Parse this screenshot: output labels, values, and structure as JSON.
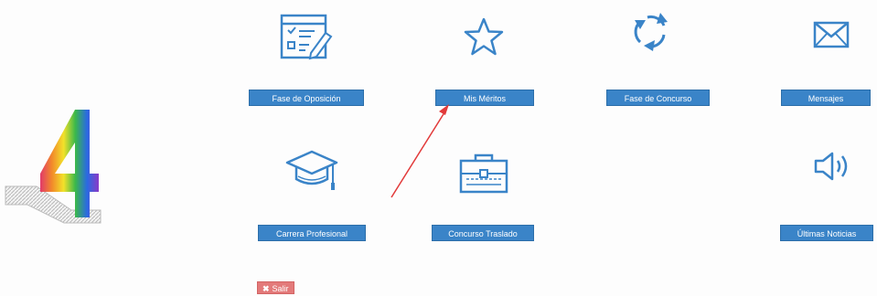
{
  "logo": {
    "glyph": "4"
  },
  "tiles": [
    {
      "label": "Fase de Oposición",
      "icon": "form-icon"
    },
    {
      "label": "Mis Méritos",
      "icon": "star-icon"
    },
    {
      "label": "Fase de Concurso",
      "icon": "refresh-icon"
    },
    {
      "label": "Mensajes",
      "icon": "envelope-icon"
    },
    {
      "label": "Carrera Profesional",
      "icon": "graduation-cap-icon"
    },
    {
      "label": "Concurso Traslado",
      "icon": "briefcase-icon"
    },
    {
      "label": "Últimas Noticias",
      "icon": "speaker-icon"
    }
  ],
  "exit": {
    "label": "Salir",
    "icon": "close-icon"
  },
  "colors": {
    "primary": "#3a84c8",
    "exit": "#e37a7a",
    "annotation": "#e23a3a"
  }
}
